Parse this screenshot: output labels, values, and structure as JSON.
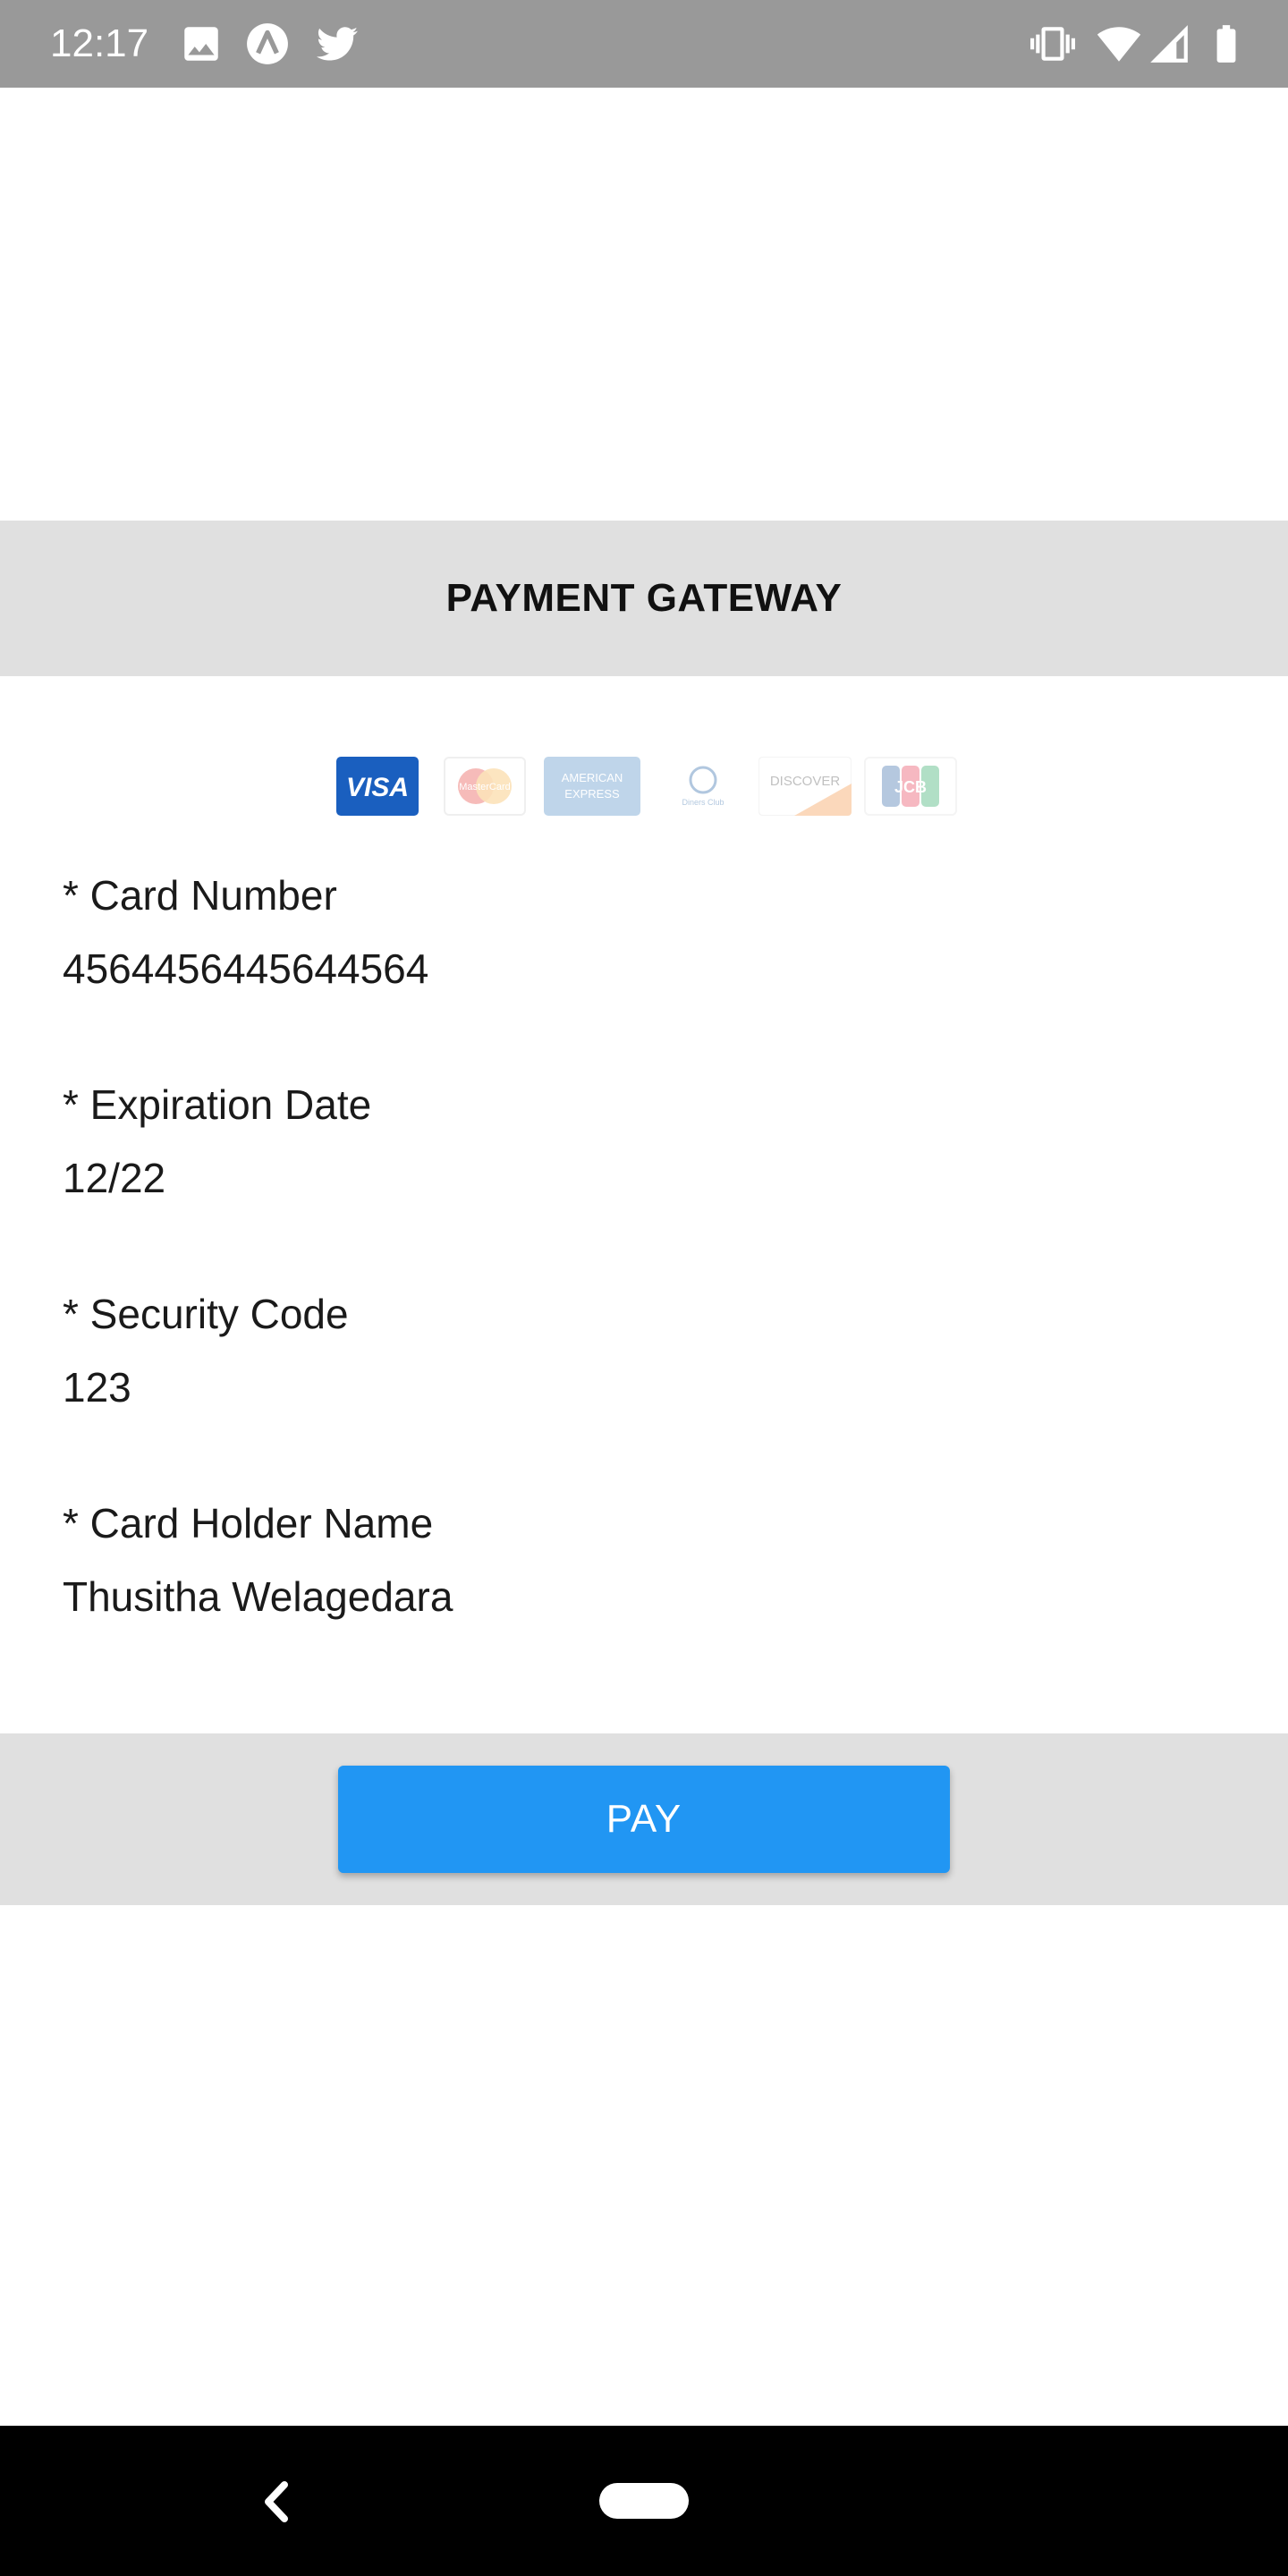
{
  "status_bar": {
    "time": "12:17",
    "left_icons": [
      "image-icon",
      "app-a-icon",
      "twitter-icon"
    ],
    "right_icons": [
      "vibrate-icon",
      "wifi-icon",
      "signal-icon",
      "battery-icon"
    ]
  },
  "header": {
    "title": "PAYMENT GATEWAY"
  },
  "card_logos": [
    "VISA",
    "MasterCard",
    "AMERICAN EXPRESS",
    "Diners Club",
    "DISCOVER",
    "JCB"
  ],
  "form": {
    "card_number": {
      "label": "* Card Number",
      "value": "4564456445644564"
    },
    "expiration_date": {
      "label": "* Expiration Date",
      "value": "12/22"
    },
    "security_code": {
      "label": "* Security Code",
      "value": "123"
    },
    "card_holder_name": {
      "label": "* Card Holder Name",
      "value": "Thusitha Welagedara"
    }
  },
  "pay_button": {
    "label": "PAY",
    "color": "#2196f3"
  },
  "nav_bar": {
    "icons": [
      "back-icon",
      "home-pill-icon"
    ]
  },
  "colors": {
    "status_bar": "#999999",
    "header_bg": "#e0e0e0",
    "visa_blue": "#1a5fbf"
  }
}
